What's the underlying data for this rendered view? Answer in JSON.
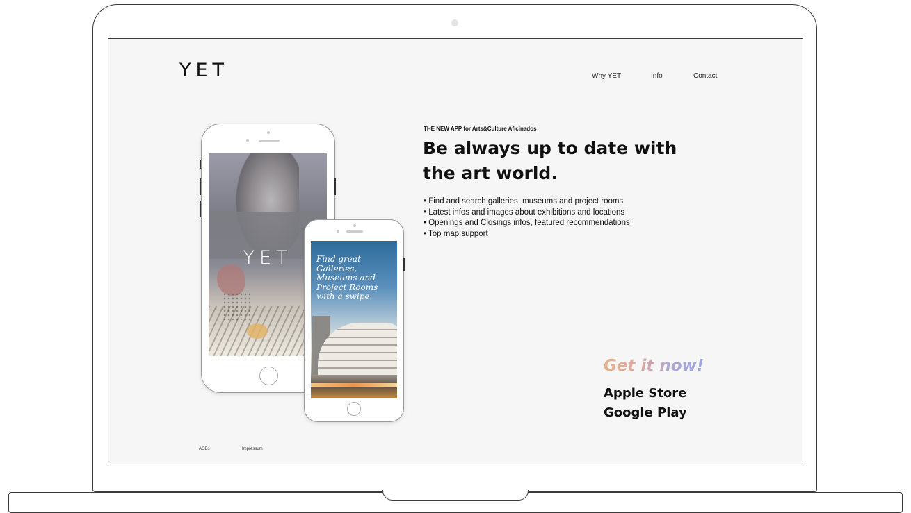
{
  "site": {
    "logo": "YET",
    "nav": [
      "Why YET",
      "Info",
      "Contact"
    ]
  },
  "hero": {
    "eyebrow": "THE NEW APP for Arts&Culture Aficinados",
    "headline": "Be always up to date with the art world.",
    "features": [
      "• Find and search galleries, museums and project rooms",
      "• Latest infos and images about exhibitions and locations",
      "• Openings and Closings infos, featured recommendations",
      "• Top map support"
    ]
  },
  "phones": {
    "big_screen_logo": "YET",
    "small_screen_tagline": "Find great Galleries, Museums and Project Rooms with a swipe."
  },
  "cta": {
    "title": "Get it now!",
    "apple": "Apple Store",
    "google": "Google Play"
  },
  "footer": [
    "AGBs",
    "Impressum"
  ],
  "colors": {
    "page_bg": "#f6f6f6",
    "text": "#111111",
    "cta_gradient_start": "#e8b08a",
    "cta_gradient_end": "#9aa4e0"
  }
}
